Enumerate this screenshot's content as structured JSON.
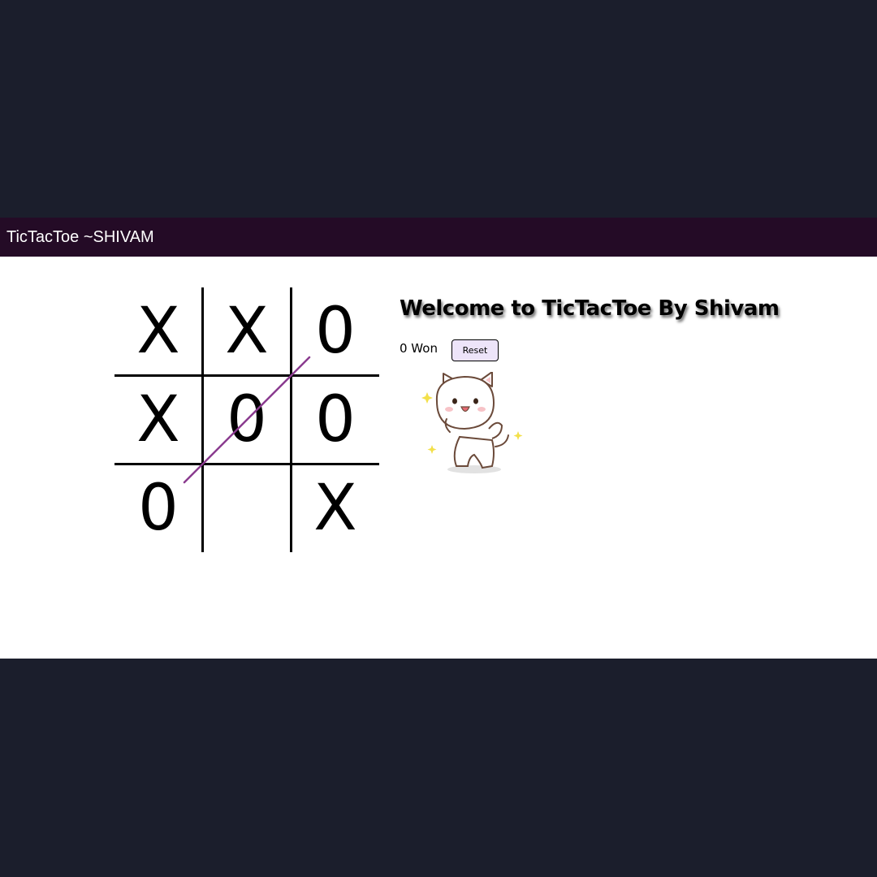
{
  "navbar": {
    "title": "TicTacToe ~SHIVAM"
  },
  "board": {
    "cells": [
      "X",
      "X",
      "0",
      "X",
      "0",
      "0",
      "0",
      "",
      "X"
    ]
  },
  "info": {
    "heading": "Welcome to TicTacToe By Shivam",
    "status": "0 Won",
    "reset_label": "Reset"
  },
  "icons": {
    "cat": "cat-sticker-icon"
  },
  "colors": {
    "navbar": "#240b26",
    "background": "#1b1e2c",
    "win_line": "#8a3b8f",
    "reset_bg": "#ede4f9"
  }
}
